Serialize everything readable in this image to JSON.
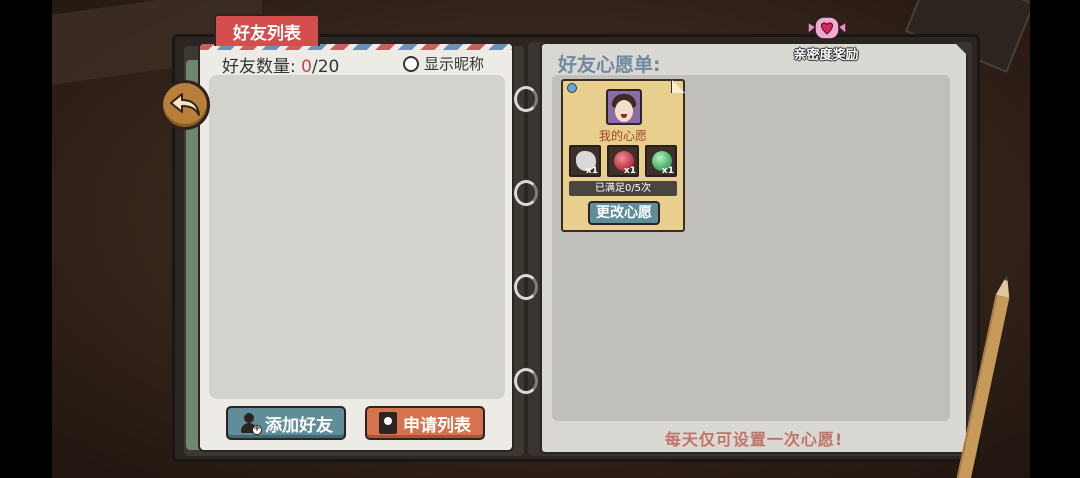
{
  "tab": {
    "label": "好友列表"
  },
  "friends": {
    "count_label": "好友数量:",
    "count_current": "0",
    "count_max": "/20",
    "show_nickname_label": "显示昵称"
  },
  "buttons": {
    "add_friend": "添加好友",
    "apply_list": "申请列表"
  },
  "wishlist": {
    "title": "好友心愿单:",
    "daily_note": "每天仅可设置一次心愿!"
  },
  "intimacy_reward": {
    "label": "亲密度奖励"
  },
  "wish_card": {
    "title": "我的心愿",
    "items": [
      {
        "name": "white-stone",
        "qty": "x1",
        "color": "#d9d9d9"
      },
      {
        "name": "red-orb",
        "qty": "x1",
        "color": "#c23a4a"
      },
      {
        "name": "green-orb",
        "qty": "x1",
        "color": "#4fb86a"
      }
    ],
    "progress": "已满足0/5次",
    "change_button": "更改心愿"
  },
  "colors": {
    "tab_red": "#d44e4e",
    "button_teal": "#5f8e9a",
    "button_orange": "#d6734d",
    "title_blue": "#6f89a1",
    "note_red": "#c0736b"
  }
}
